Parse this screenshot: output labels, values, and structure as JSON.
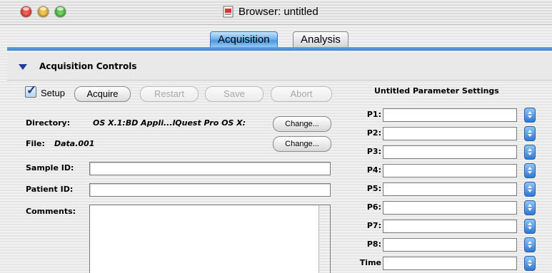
{
  "window": {
    "title": "Browser: untitled"
  },
  "tabs": [
    {
      "label": "Acquisition",
      "active": true
    },
    {
      "label": "Analysis",
      "active": false
    }
  ],
  "section": {
    "title": "Acquisition Controls"
  },
  "controls": {
    "setup_label": "Setup",
    "setup_checked": true,
    "acquire": "Acquire",
    "restart": "Restart",
    "save": "Save",
    "abort": "Abort"
  },
  "fields": {
    "directory_label": "Directory:",
    "directory_value": "OS X.1:BD Appli...lQuest Pro OS X:",
    "directory_change": "Change...",
    "file_label": "File:",
    "file_value": "Data.001",
    "file_change": "Change...",
    "sample_id_label": "Sample ID:",
    "sample_id_value": "",
    "patient_id_label": "Patient ID:",
    "patient_id_value": "",
    "comments_label": "Comments:",
    "comments_value": ""
  },
  "params": {
    "title": "Untitled Parameter Settings",
    "items": [
      {
        "label": "P1:",
        "value": ""
      },
      {
        "label": "P2:",
        "value": ""
      },
      {
        "label": "P3:",
        "value": ""
      },
      {
        "label": "P4:",
        "value": ""
      },
      {
        "label": "P5:",
        "value": ""
      },
      {
        "label": "P6:",
        "value": ""
      },
      {
        "label": "P7:",
        "value": ""
      },
      {
        "label": "P8:",
        "value": ""
      },
      {
        "label": "Time",
        "value": ""
      }
    ]
  },
  "colors": {
    "accent": "#4a97e0",
    "disclosure": "#1e3c9c"
  }
}
